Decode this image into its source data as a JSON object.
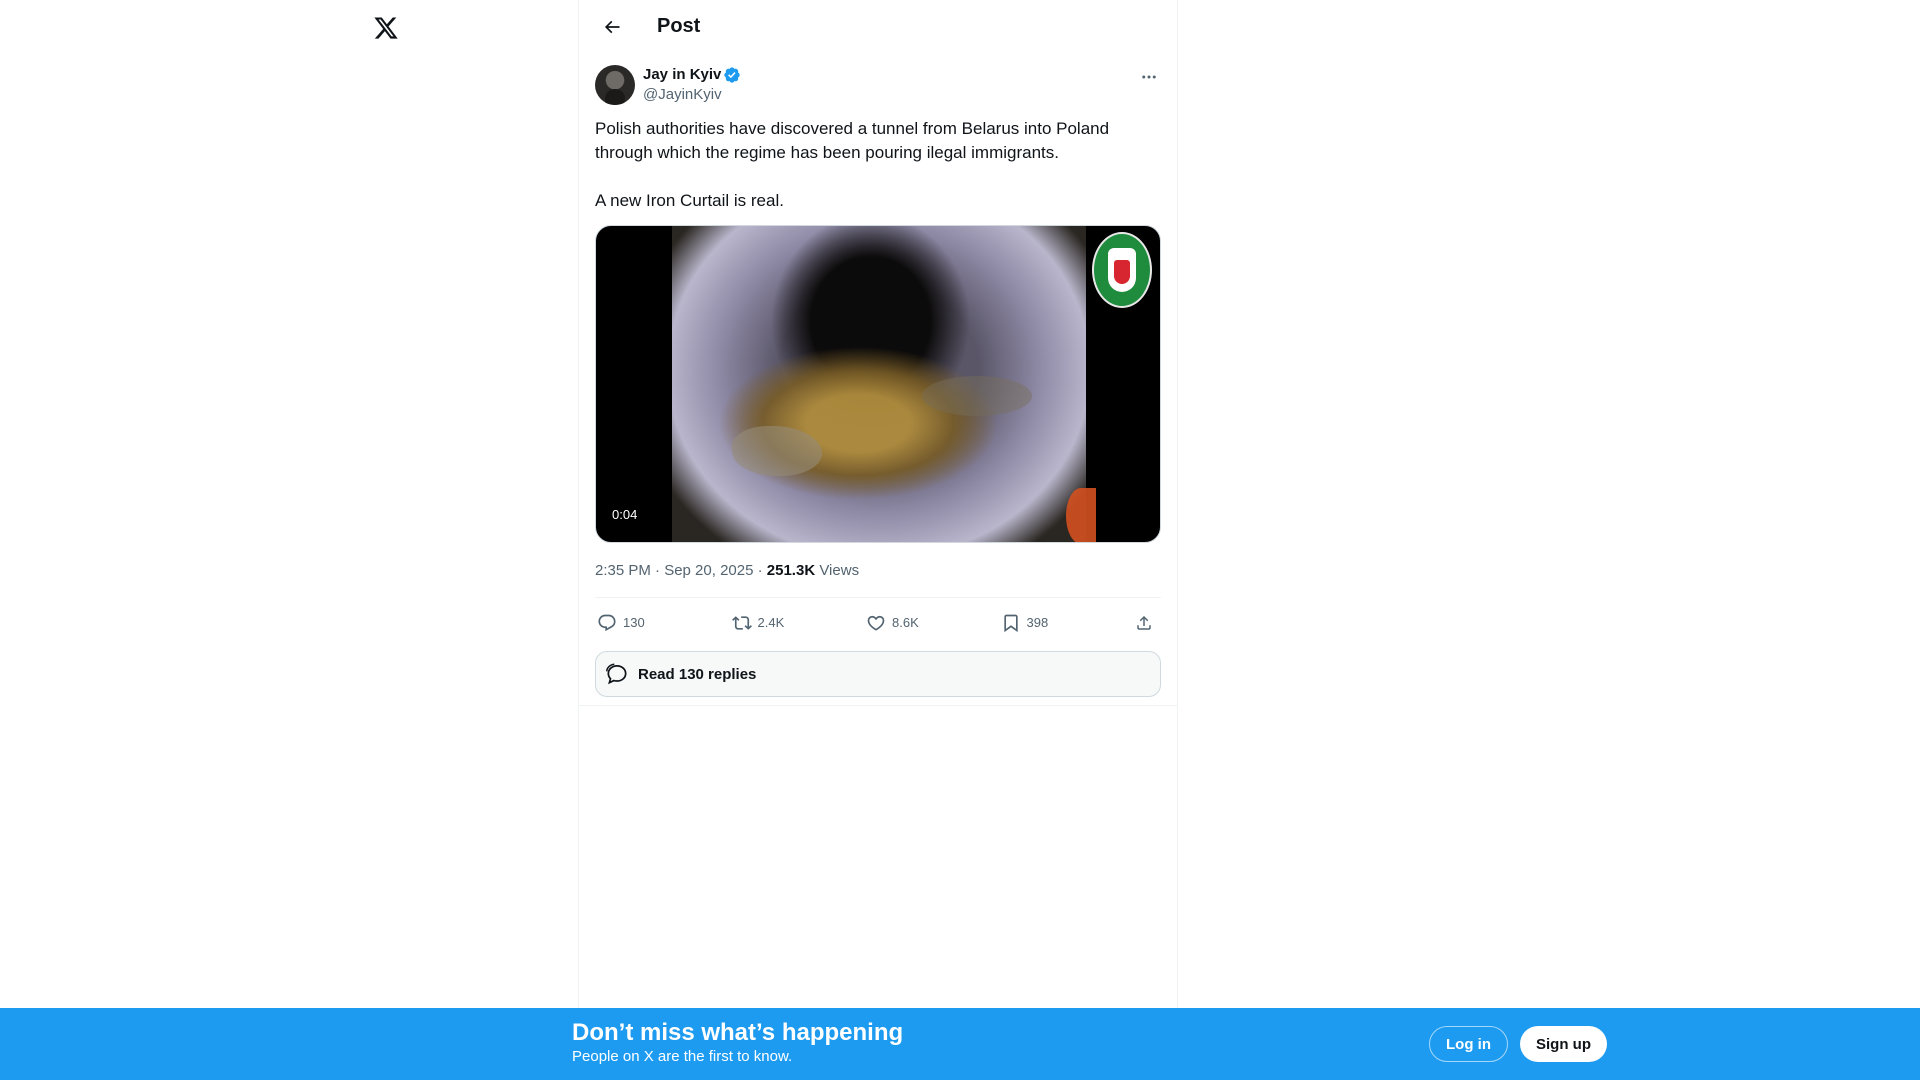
{
  "header": {
    "title": "Post"
  },
  "post": {
    "author": {
      "name": "Jay in Kyiv",
      "handle": "@JayinKyiv"
    },
    "text": "Polish authorities have discovered a tunnel from Belarus into Poland through which the regime has been pouring ilegal immigrants.\n\nA new Iron Curtail is real.",
    "media": {
      "duration": "0:04"
    },
    "meta": {
      "time_date": "2:35 PM · Sep 20, 2025 · ",
      "views_count": "251.3K",
      "views_label": " Views"
    },
    "stats": {
      "replies": "130",
      "reposts": "2.4K",
      "likes": "8.6K",
      "bookmarks": "398"
    },
    "read_replies_label": "Read 130 replies"
  },
  "banner": {
    "title": "Don’t miss what’s happening",
    "subtitle": "People on X are the first to know.",
    "login_label": "Log in",
    "signup_label": "Sign up"
  },
  "colors": {
    "accent": "#1d9bf0",
    "text_primary": "#0f1419",
    "text_secondary": "#536471"
  }
}
